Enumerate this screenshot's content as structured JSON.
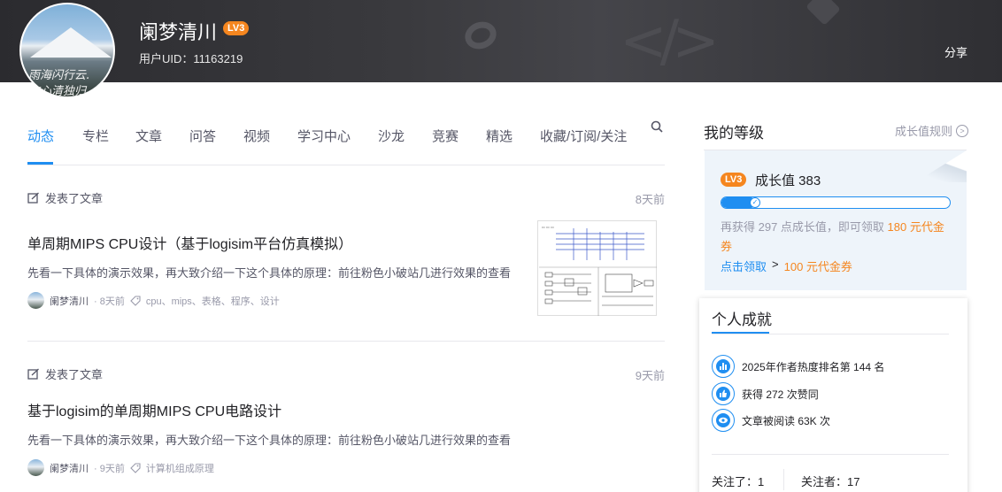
{
  "header": {
    "username": "阑梦清川",
    "level": "LV3",
    "uid_label": "用户UID：11163219",
    "share": "分享",
    "avatar_caption_line1": "雨海闪行云.",
    "avatar_caption_line2": "在心清独归"
  },
  "tabs": [
    {
      "label": "动态",
      "active": true
    },
    {
      "label": "专栏"
    },
    {
      "label": "文章"
    },
    {
      "label": "问答"
    },
    {
      "label": "视频"
    },
    {
      "label": "学习中心"
    },
    {
      "label": "沙龙"
    },
    {
      "label": "竞赛"
    },
    {
      "label": "精选"
    },
    {
      "label": "收藏/订阅/关注"
    }
  ],
  "feed": [
    {
      "action": "发表了文章",
      "time": "8天前",
      "title": "单周期MIPS CPU设计（基于logisim平台仿真模拟）",
      "desc": "先看一下具体的演示效果，再大致介绍一下这个具体的原理：前往粉色小破站几进行效果的查看",
      "author": "阑梦清川",
      "meta_time": "· 8天前",
      "tags": "cpu、mips、表格、程序、设计"
    },
    {
      "action": "发表了文章",
      "time": "9天前",
      "title": "基于logisim的单周期MIPS CPU电路设计",
      "desc": "先看一下具体的演示效果，再大致介绍一下这个具体的原理：前往粉色小破站几进行效果的查看",
      "author": "阑梦清川",
      "meta_time": "· 9天前",
      "tags": "计算机组成原理"
    }
  ],
  "level": {
    "title": "我的等级",
    "rule": "成长值规则",
    "badge": "LV3",
    "growth": "成长值 383",
    "progress": 0.15,
    "hint_prefix": "再获得 297 点成长值，即可领取",
    "hint_amount": "180 元代金券",
    "claim": "点击领取",
    "claim_arrow": ">",
    "claim_coupon": "100 元代金券"
  },
  "achievements": {
    "title": "个人成就",
    "items": [
      {
        "icon": "bar-chart-icon",
        "text": "2025年作者热度排名第 144 名"
      },
      {
        "icon": "thumbs-up-icon",
        "text": "获得 272 次赞同"
      },
      {
        "icon": "eye-icon",
        "text": "文章被阅读 63K 次"
      }
    ],
    "following": "关注了：1",
    "followers": "关注者：17"
  },
  "colors": {
    "accent": "#1f8ef1",
    "level": "#f5861f"
  }
}
